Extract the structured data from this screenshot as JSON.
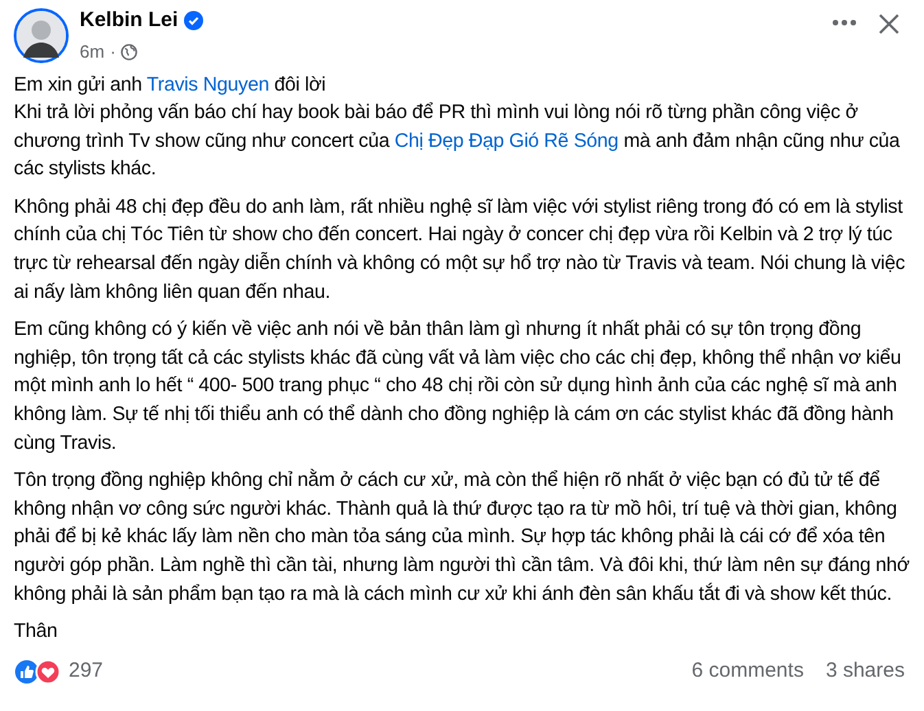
{
  "author": {
    "name": "Kelbin Lei",
    "verified": true,
    "time": "6m",
    "separator": "·"
  },
  "paragraphs": [
    {
      "lines": [
        [
          {
            "text": "Em xin gửi anh ",
            "link": false
          },
          {
            "text": "Travis Nguyen",
            "link": true
          },
          {
            "text": " đôi lời",
            "link": false
          }
        ],
        [
          {
            "text": "Khi trả lời phỏng vấn báo chí hay book bài báo để PR thì mình vui lòng nói rõ từng phần công việc ở chương trình Tv show cũng như concert của ",
            "link": false
          },
          {
            "text": "Chị Đẹp Đạp Gió Rẽ Sóng",
            "link": true
          },
          {
            "text": " mà anh đảm nhận cũng như của các stylists khác.",
            "link": false
          }
        ]
      ]
    },
    {
      "lines": [
        [
          {
            "text": "Không phải 48 chị đẹp đều do anh làm, rất nhiều nghệ sĩ làm việc với stylist riêng trong đó có em là stylist chính của chị Tóc Tiên từ show cho đến concert. Hai ngày ở concer chị đẹp vừa rồi Kelbin và 2 trợ lý túc trực từ rehearsal đến ngày diễn chính và không có một sự hổ trợ nào từ Travis và team. Nói chung là việc ai nấy làm không liên quan đến nhau.",
            "link": false
          }
        ]
      ]
    },
    {
      "lines": [
        [
          {
            "text": "Em cũng không có ý kiến về việc anh nói về bản thân làm gì nhưng ít nhất phải có sự tôn trọng đồng nghiệp, tôn trọng tất cả các stylists khác đã cùng vất vả làm việc cho các chị đẹp, không thể nhận vơ kiểu một mình anh lo hết “ 400- 500 trang phục “ cho 48 chị rồi còn sử dụng hình ảnh của các nghệ sĩ mà anh không làm. Sự tế nhị tối thiểu anh có thể dành cho đồng nghiệp là cám ơn các stylist khác đã đồng hành cùng Travis.",
            "link": false
          }
        ]
      ]
    },
    {
      "lines": [
        [
          {
            "text": "Tôn trọng đồng nghiệp không chỉ nằm ở cách cư xử, mà còn thể hiện rõ nhất ở việc bạn có đủ tử tế để không nhận vơ công sức người khác. Thành quả là thứ được tạo ra từ mồ hôi, trí tuệ và thời gian, không phải để bị kẻ khác lấy làm nền cho màn tỏa sáng của mình. Sự hợp tác không phải là cái cớ để xóa tên người góp phần. Làm nghề thì cần tài, nhưng làm người thì cần tâm. Và đôi khi, thứ làm nên sự đáng nhớ không phải là sản phẩm bạn tạo ra mà là cách mình cư xử khi ánh đèn sân khấu tắt đi và show kết thúc.",
            "link": false
          }
        ]
      ]
    },
    {
      "lines": [
        [
          {
            "text": "Thân",
            "link": false
          }
        ]
      ]
    }
  ],
  "footer": {
    "reaction_count": "297",
    "comments": "6 comments",
    "shares": "3 shares"
  }
}
